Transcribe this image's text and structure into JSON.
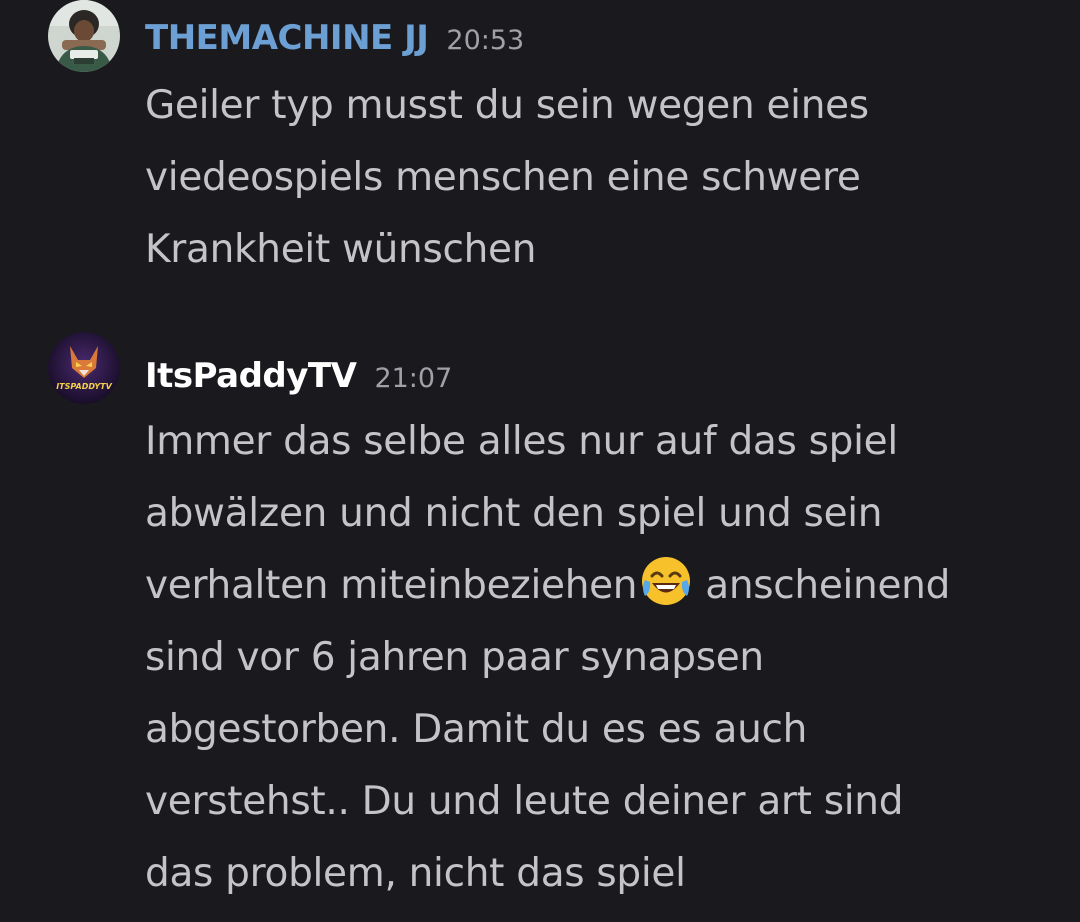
{
  "messages": [
    {
      "author": "THEMACHINE JJ",
      "time": "20:53",
      "avatar_icon": "user-avatar-photo",
      "lines": [
        "Geiler typ musst du sein wegen eines",
        "viedeospiels menschen eine schwere",
        "Krankheit wünschen"
      ]
    },
    {
      "author": "ItsPaddyTV",
      "time": "21:07",
      "avatar_icon": "fox-logo-avatar",
      "avatar_text": "ITSPADDYTV",
      "lines": [
        "Immer das selbe alles nur auf das spiel",
        "abwälzen und nicht den spiel und sein",
        "verhalten miteinbeziehen",
        "anscheinend",
        "sind vor 6 jahren paar synapsen",
        "abgestorben. Damit du es es auch",
        "verstehst.. Du und leute deiner art sind",
        "das problem, nicht das spiel"
      ],
      "inline_emoji": "face-with-tears-of-joy-emoji"
    }
  ],
  "colors": {
    "background": "#1a1a1e",
    "author_1": "#6c9fd4",
    "author_2": "#ffffff",
    "text": "#c4c4c8",
    "timestamp": "#a0a0a6"
  }
}
